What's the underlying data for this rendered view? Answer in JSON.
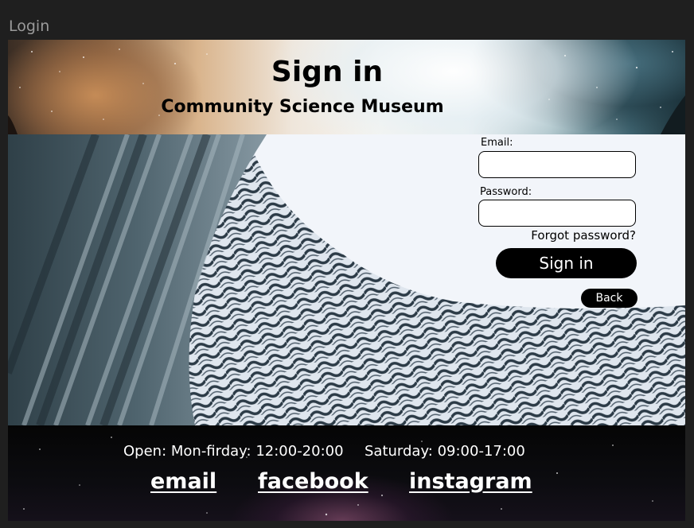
{
  "window": {
    "title": "Login"
  },
  "header": {
    "title": "Sign in",
    "subtitle": "Community Science Museum"
  },
  "form": {
    "email_label": "Email:",
    "email_value": "",
    "password_label": "Password:",
    "password_value": "",
    "forgot_label": "Forgot password?",
    "signin_label": "Sign in",
    "back_label": "Back"
  },
  "footer": {
    "hours_weekday": "Open: Mon-firday: 12:00-20:00",
    "hours_saturday": "Saturday: 09:00-17:00",
    "links": [
      "email",
      "facebook",
      "instagram"
    ]
  },
  "colors": {
    "button": "#000000",
    "button_text": "#ffffff",
    "frame_bg": "#1f1f1f"
  }
}
